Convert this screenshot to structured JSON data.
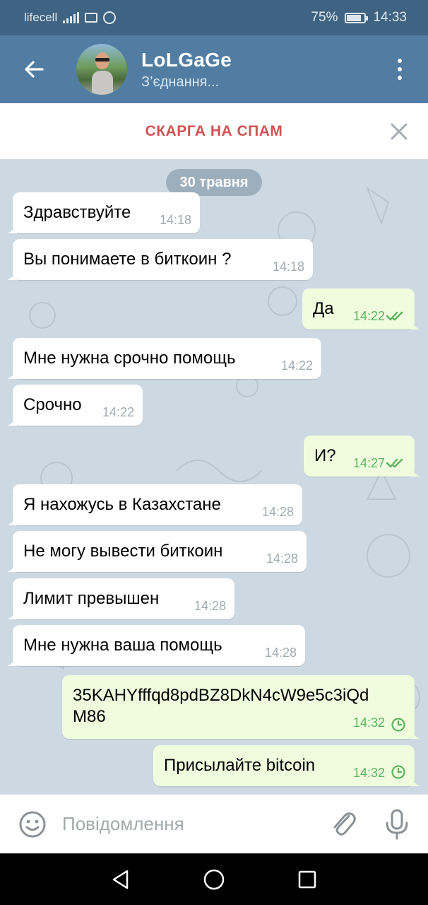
{
  "status_bar": {
    "carrier": "lifecell",
    "battery": "75%",
    "battery_level": 0.75,
    "time": "14:33"
  },
  "header": {
    "chat_name": "LoLGaGe",
    "chat_status": "З’єднання...",
    "icons": {
      "back": "arrow-left",
      "menu": "more-vertical"
    }
  },
  "spam_bar": {
    "label": "СКАРГА НА СПАМ"
  },
  "chat": {
    "date": "30 травня",
    "messages": [
      {
        "direction": "in",
        "text": "Здравствуйте",
        "time": "14:18"
      },
      {
        "direction": "in",
        "text": "Вы понимаете в биткоин ?",
        "time": "14:18"
      },
      {
        "direction": "out",
        "text": "Да",
        "time": "14:22",
        "status": "read"
      },
      {
        "direction": "in",
        "text": "Мне нужна срочно помощь",
        "time": "14:22"
      },
      {
        "direction": "in",
        "text": "Срочно",
        "time": "14:22"
      },
      {
        "direction": "out",
        "text": "И?",
        "time": "14:27",
        "status": "read"
      },
      {
        "direction": "in",
        "text": "Я нахожусь в Казахстане",
        "time": "14:28"
      },
      {
        "direction": "in",
        "text": "Не могу вывести биткоин",
        "time": "14:28"
      },
      {
        "direction": "in",
        "text": "Лимит превышен",
        "time": "14:28"
      },
      {
        "direction": "in",
        "text": "Мне нужна ваша помощь",
        "time": "14:28"
      },
      {
        "direction": "out",
        "text_line1": "35KAHYfffqd8pdBZ8DkN4cW9e5c3iQd",
        "text_line2": "M86",
        "time": "14:32",
        "status": "pending"
      },
      {
        "direction": "out",
        "text": "Присылайте bitcoin",
        "time": "14:32",
        "status": "pending"
      }
    ]
  },
  "input_bar": {
    "placeholder": "Повідомлення",
    "value": "",
    "icons": {
      "emoji": "emoji-icon",
      "attach": "paperclip-icon",
      "mic": "microphone-icon"
    }
  },
  "colors": {
    "header": "#517da2",
    "status_bar": "#3f6382",
    "chat_background": "#cdd9e2",
    "incoming_bubble": "#ffffff",
    "outgoing_bubble": "#effdde",
    "spam_red": "#cf5454",
    "read_check": "#5eb25f"
  }
}
